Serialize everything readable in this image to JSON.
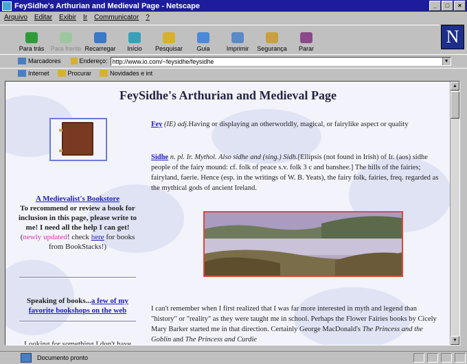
{
  "window": {
    "title": "FeySidhe's Arthurian and Medieval Page - Netscape"
  },
  "menu": [
    "Arquivo",
    "Editar",
    "Exibir",
    "Ir",
    "Communicator",
    "?"
  ],
  "toolbar": {
    "buttons": [
      {
        "label": "Para trás",
        "icon": "back-arrow-icon"
      },
      {
        "label": "Para frente",
        "icon": "forward-arrow-icon"
      },
      {
        "label": "Recarregar",
        "icon": "reload-icon"
      },
      {
        "label": "Início",
        "icon": "home-icon"
      },
      {
        "label": "Pesquisar",
        "icon": "search-icon"
      },
      {
        "label": "Guia",
        "icon": "guide-icon"
      },
      {
        "label": "Imprimir",
        "icon": "print-icon"
      },
      {
        "label": "Segurança",
        "icon": "security-icon"
      },
      {
        "label": "Parar",
        "icon": "stop-icon"
      }
    ],
    "logo": "N"
  },
  "location": {
    "bookmarks_label": "Marcadores",
    "address_label": "Endereço:",
    "url": "http://www.io.com/~feysidhe/feysidhe"
  },
  "personal_bar": [
    "Internet",
    "Procurar",
    "Novidades e int"
  ],
  "page": {
    "title": "FeySidhe's Arthurian and Medieval Page",
    "left": {
      "bookstore_link": "A Medievalist's Bookstore",
      "bookstore_text": "To recommend or review a book for inclusion in this page, please write to me! I need all the help I can get!",
      "updated": "newly updated",
      "check_text": "! check",
      "here_link": "here",
      "for_text": "for books from BookStacks!)",
      "open_paren": "(",
      "speaking": "Speaking of books...",
      "favorites_link": "a few of my favorite bookshops on the web",
      "looking": "Looking for something I don't have"
    },
    "fey": {
      "term": "Fey",
      "pos": "(IE) adj.",
      "def": "Having or displaying an otherworldly, magical, or fairylike aspect or quality"
    },
    "sidhe": {
      "term": "Sidhe",
      "pos": "n. pl. Ir. Mythol. Also sidhe and (sing.) Sidh.",
      "def": "[Ellipsis (not found in Irish) of Ir. (aos) sidhe people of the fairy mound: cf. folk of peace s.v. folk 3 c and banshee.] The hills of the fairies; fairyland, faerie. Hence (esp. in the writings of W. B. Yeats), the fairy folk, fairies, freq. regarded as the mythical gods of ancient Ireland."
    },
    "story": {
      "text1": "I can't remember when I first realized that I was far more interested in myth and legend than \"history\" or \"reality\" as they were taught me in school. Perhaps the Flower Fairies books by Cicely Mary Barker started me in that direction. Certainly George MacDonald's",
      "book1": "The Princess and the Goblin",
      "and": "and",
      "book2": "The Princess and Curdie"
    }
  },
  "status": {
    "text": "Documento pronto"
  }
}
